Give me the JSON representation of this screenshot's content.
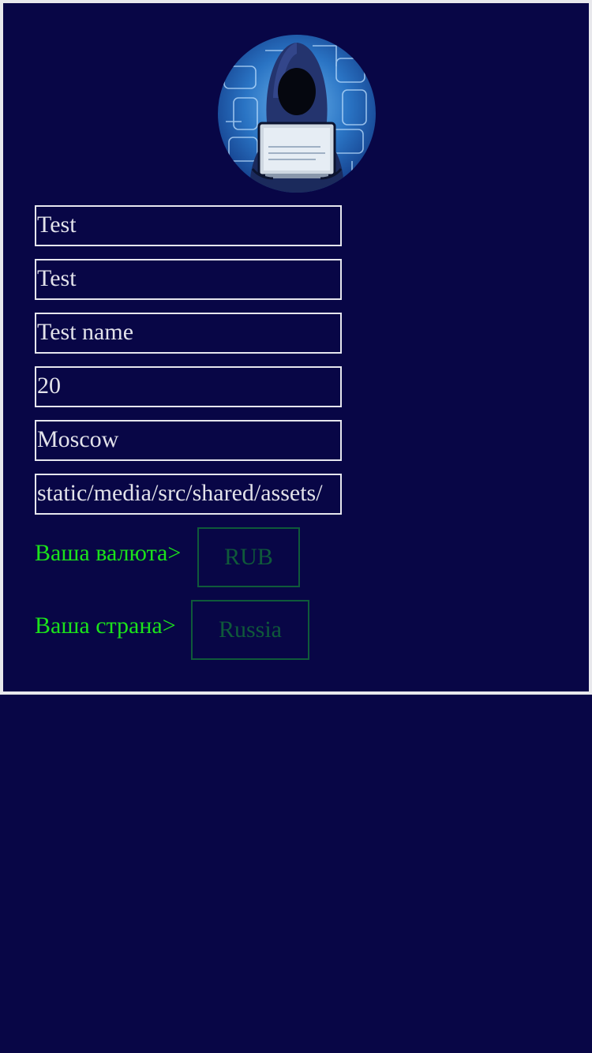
{
  "profile": {
    "avatar_icon": "hacker-avatar-icon",
    "fields": [
      {
        "name": "first-name-field",
        "value": "Test"
      },
      {
        "name": "last-name-field",
        "value": "Test"
      },
      {
        "name": "username-field",
        "value": "Test name"
      },
      {
        "name": "age-field",
        "value": "20"
      },
      {
        "name": "city-field",
        "value": "Moscow"
      },
      {
        "name": "avatar-path-field",
        "value": "static/media/src/shared/assets/"
      }
    ]
  },
  "currency": {
    "label": "Ваша валюта>",
    "value": "RUB"
  },
  "country": {
    "label": "Ваша страна>",
    "value": "Russia"
  },
  "colors": {
    "background": "#080646",
    "label_green": "#1be21b",
    "button_green": "#0f5a3a",
    "field_border": "#e6e6ee"
  }
}
